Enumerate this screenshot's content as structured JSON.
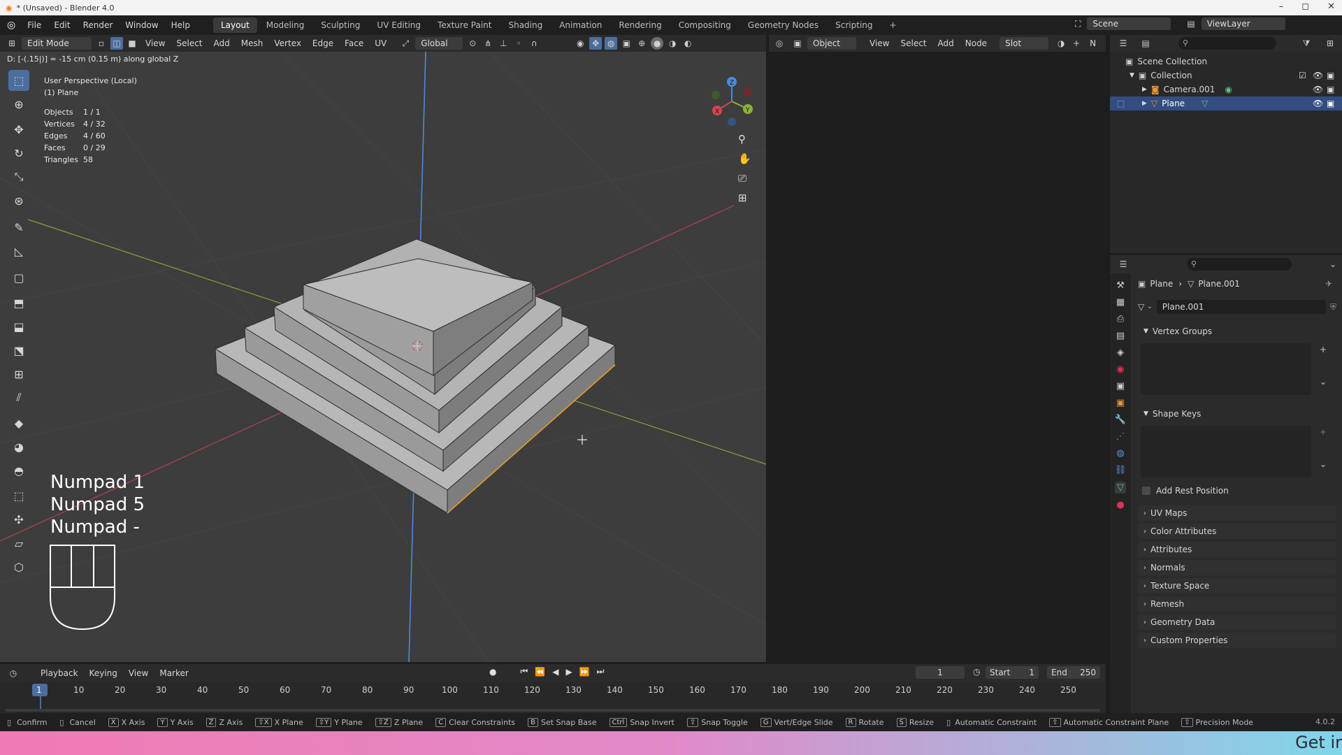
{
  "window": {
    "title": "* (Unsaved) - Blender 4.0",
    "controls": [
      "–",
      "◻",
      "✕"
    ]
  },
  "topbar": {
    "menus": [
      "File",
      "Edit",
      "Render",
      "Window",
      "Help"
    ],
    "workspaces": [
      "Layout",
      "Modeling",
      "Sculpting",
      "UV Editing",
      "Texture Paint",
      "Shading",
      "Animation",
      "Rendering",
      "Compositing",
      "Geometry Nodes",
      "Scripting"
    ],
    "active_workspace": "Layout",
    "add_tab": "+",
    "scene": "Scene",
    "view_layer": "ViewLayer"
  },
  "viewport_header": {
    "mode": "Edit Mode",
    "menus": [
      "View",
      "Select",
      "Add",
      "Mesh",
      "Vertex",
      "Edge",
      "Face",
      "UV"
    ],
    "transform_orientation": "Global"
  },
  "operator_feedback": "D: [-(.15|)] = -15 cm (0.15 m) along global Z",
  "overlay": {
    "view_name": "User Perspective (Local)",
    "object_name": "(1) Plane",
    "stats": [
      {
        "label": "Objects",
        "value": "1 / 1"
      },
      {
        "label": "Vertices",
        "value": "4 / 32"
      },
      {
        "label": "Edges",
        "value": "4 / 60"
      },
      {
        "label": "Faces",
        "value": "0 / 29"
      },
      {
        "label": "Triangles",
        "value": "58"
      }
    ],
    "keys": [
      "Numpad 1",
      "Numpad 5",
      "Numpad -"
    ]
  },
  "gizmo": {
    "x": "X",
    "y": "Y",
    "z": "Z"
  },
  "node_header": {
    "object_dropdown": "Object",
    "menus": [
      "View",
      "Select",
      "Add",
      "Node"
    ],
    "slot": "Slot",
    "extra": "N"
  },
  "outliner": {
    "items": [
      {
        "label": "Scene Collection",
        "level": 0
      },
      {
        "label": "Collection",
        "level": 1
      },
      {
        "label": "Camera.001",
        "level": 2
      },
      {
        "label": "Plane",
        "level": 2,
        "selected": true
      }
    ]
  },
  "properties": {
    "breadcrumb_object": "Plane",
    "breadcrumb_data": "Plane.001",
    "data_name": "Plane.001",
    "sections_open": [
      "Vertex Groups",
      "Shape Keys"
    ],
    "add_rest_position": "Add Rest Position",
    "sections_closed": [
      "UV Maps",
      "Color Attributes",
      "Attributes",
      "Normals",
      "Texture Space",
      "Remesh",
      "Geometry Data",
      "Custom Properties"
    ]
  },
  "timeline": {
    "menus": [
      "Playback",
      "Keying",
      "View",
      "Marker"
    ],
    "current_frame": "1",
    "start_label": "Start",
    "start": "1",
    "end_label": "End",
    "end": "250",
    "ticks": [
      "1",
      "10",
      "20",
      "30",
      "40",
      "50",
      "60",
      "70",
      "80",
      "90",
      "100",
      "110",
      "120",
      "130",
      "140",
      "150",
      "160",
      "170",
      "180",
      "190",
      "200",
      "210",
      "220",
      "230",
      "240",
      "250"
    ]
  },
  "statusbar": {
    "items": [
      {
        "key": "",
        "label": "Confirm"
      },
      {
        "key": "",
        "label": "Cancel"
      },
      {
        "key": "X",
        "label": "X Axis"
      },
      {
        "key": "Y",
        "label": "Y Axis"
      },
      {
        "key": "Z",
        "label": "Z Axis"
      },
      {
        "key": "⇧X",
        "label": "X Plane"
      },
      {
        "key": "⇧Y",
        "label": "Y Plane"
      },
      {
        "key": "⇧Z",
        "label": "Z Plane"
      },
      {
        "key": "C",
        "label": "Clear Constraints"
      },
      {
        "key": "B",
        "label": "Set Snap Base"
      },
      {
        "key": "Ctrl",
        "label": "Snap Invert"
      },
      {
        "key": "⇧",
        "label": "Snap Toggle"
      },
      {
        "key": "G",
        "label": "Vert/Edge Slide"
      },
      {
        "key": "R",
        "label": "Rotate"
      },
      {
        "key": "S",
        "label": "Resize"
      },
      {
        "key": "",
        "label": "Automatic Constraint"
      },
      {
        "key": "⇧",
        "label": "Automatic Constraint Plane"
      },
      {
        "key": "⇧",
        "label": "Precision Mode"
      }
    ],
    "version": "4.0.2"
  },
  "bottom_strip": {
    "text": "Get ir"
  }
}
